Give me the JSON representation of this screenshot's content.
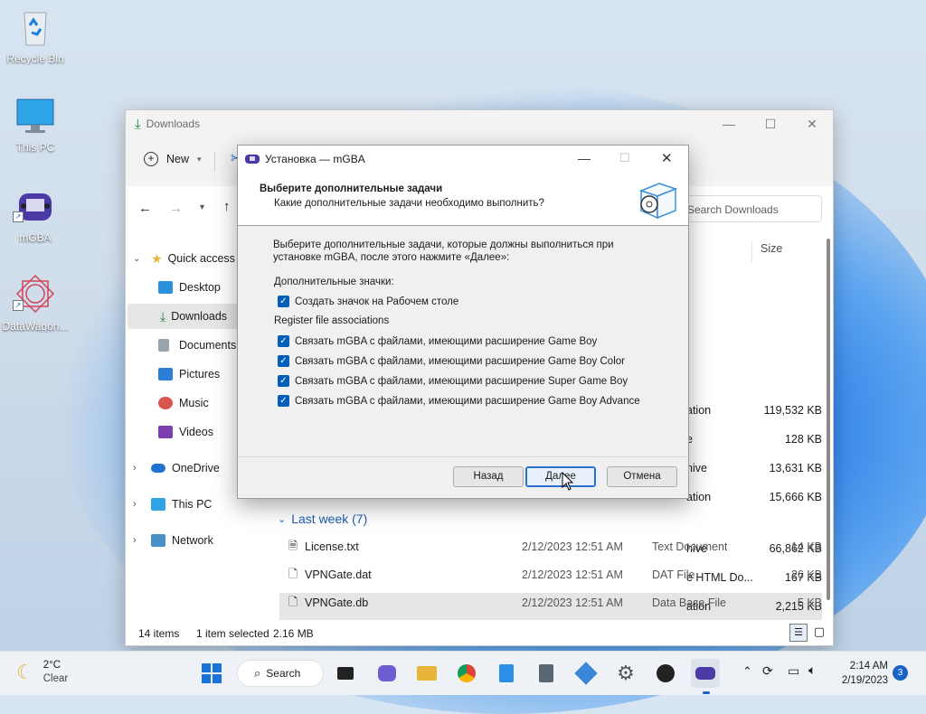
{
  "desktop": {
    "icons": [
      {
        "label": "Recycle Bin"
      },
      {
        "label": "This PC"
      },
      {
        "label": "mGBA"
      },
      {
        "label": "DataWagon..."
      }
    ]
  },
  "explorer": {
    "title": "Downloads",
    "new_label": "New",
    "search_placeholder": "Search Downloads",
    "nav": {
      "quick_access": "Quick access",
      "desktop": "Desktop",
      "downloads": "Downloads",
      "documents": "Documents",
      "pictures": "Pictures",
      "music": "Music",
      "videos": "Videos",
      "onedrive": "OneDrive",
      "this_pc": "This PC",
      "network": "Network"
    },
    "column_size": "Size",
    "partial_rows": [
      {
        "type": "ation",
        "size": "119,532 KB"
      },
      {
        "type": "e",
        "size": "128 KB"
      },
      {
        "type": "hive",
        "size": "13,631 KB"
      },
      {
        "type": "ation",
        "size": "15,666 KB"
      },
      {
        "type": "hive",
        "size": "66,862 KB"
      },
      {
        "type": "e HTML Do...",
        "size": "167 KB"
      },
      {
        "type": "ation",
        "size": "2,215 KB"
      }
    ],
    "group_last_week": "Last week (7)",
    "files": [
      {
        "name": "License.txt",
        "date": "2/12/2023 12:51 AM",
        "type": "Text Document",
        "size": "14 KB"
      },
      {
        "name": "VPNGate.dat",
        "date": "2/12/2023 12:51 AM",
        "type": "DAT File",
        "size": "26 KB"
      },
      {
        "name": "VPNGate.db",
        "date": "2/12/2023 12:51 AM",
        "type": "Data Base File",
        "size": "5 KB"
      }
    ],
    "status": {
      "items": "14 items",
      "selected": "1 item selected",
      "size": "2.16 MB"
    }
  },
  "dialog": {
    "title": "Установка — mGBA",
    "heading": "Выберите дополнительные задачи",
    "subheading": "Какие дополнительные задачи необходимо выполнить?",
    "intro_line1": "Выберите дополнительные задачи, которые должны выполниться при",
    "intro_line2": "установке mGBA, после этого нажмите «Далее»:",
    "group_icons": "Дополнительные значки:",
    "opt_desktop_icon": "Создать значок на Рабочем столе",
    "group_assoc": "Register file associations",
    "assoc": [
      "Связать mGBA с файлами, имеющими расширение Game Boy",
      "Связать mGBA с файлами, имеющими расширение Game Boy Color",
      "Связать mGBA с файлами, имеющими расширение Super Game Boy",
      "Связать mGBA с файлами, имеющими расширение Game Boy Advance"
    ],
    "btn_back": "Назад",
    "btn_next": "Далее",
    "btn_cancel": "Отмена",
    "checked": true
  },
  "taskbar": {
    "weather_temp": "2°C",
    "weather_desc": "Clear",
    "search_label": "Search",
    "time": "2:14 AM",
    "date": "2/19/2023",
    "notification_count": "3"
  },
  "colors": {
    "accent": "#005fb8",
    "folder": "#e8b53a",
    "selection": "#e5e5e5"
  }
}
